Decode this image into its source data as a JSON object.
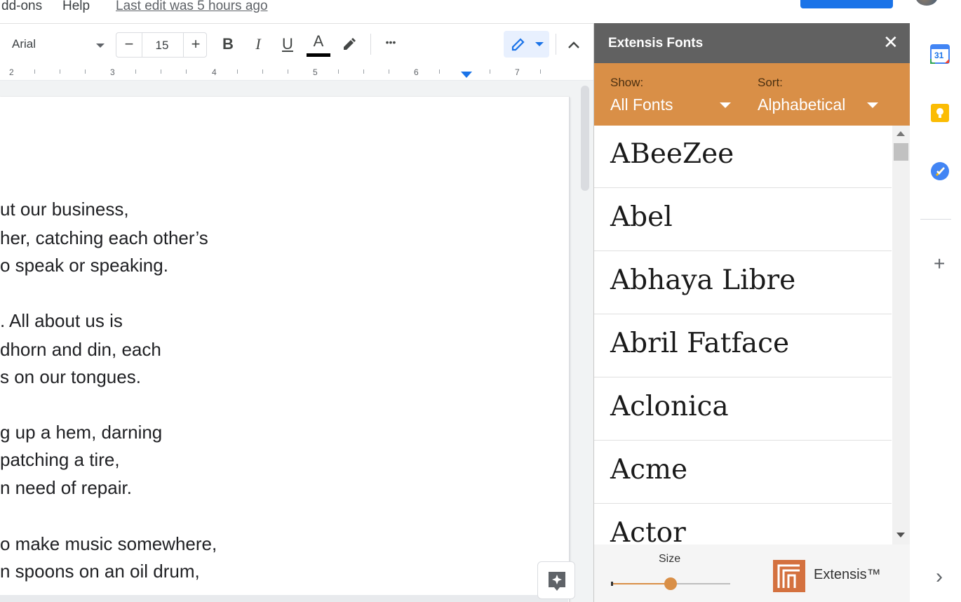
{
  "menu": {
    "items": [
      "dd-ons",
      "Help"
    ],
    "last_edit": "Last edit was 5 hours ago"
  },
  "toolbar": {
    "font": "Arial",
    "font_size": "15",
    "decrease_label": "−",
    "increase_label": "+",
    "bold": "B",
    "italic": "I",
    "underline": "U",
    "text_color": "A",
    "more": "•••"
  },
  "ruler": {
    "numbers": [
      "2",
      "3",
      "4",
      "5",
      "6",
      "7"
    ]
  },
  "document": {
    "lines": [
      "ut our business,",
      "her, catching each other’s",
      "o speak or speaking.",
      ". All about us is",
      "dhorn and din, each",
      "s on our tongues.",
      "g up a hem, darning",
      "patching a tire,",
      "n need of repair.",
      "o make music somewhere,",
      "n spoons on an oil drum,"
    ]
  },
  "sidebar": {
    "title": "Extensis Fonts",
    "close": "✕",
    "show_label": "Show:",
    "show_value": "All Fonts",
    "sort_label": "Sort:",
    "sort_value": "Alphabetical",
    "fonts": [
      "ABeeZee",
      "Abel",
      "Abhaya Libre",
      "Abril Fatface",
      "Aclonica",
      "Acme",
      "Actor"
    ],
    "size_label": "Size",
    "size_value_fraction": 0.5,
    "brand": "Extensis™"
  },
  "colors": {
    "accent_orange": "#d98f47",
    "header_gray": "#616161",
    "share_blue": "#1a73e8"
  },
  "rail": {
    "calendar_day": "31",
    "add": "+",
    "expand": "›"
  }
}
